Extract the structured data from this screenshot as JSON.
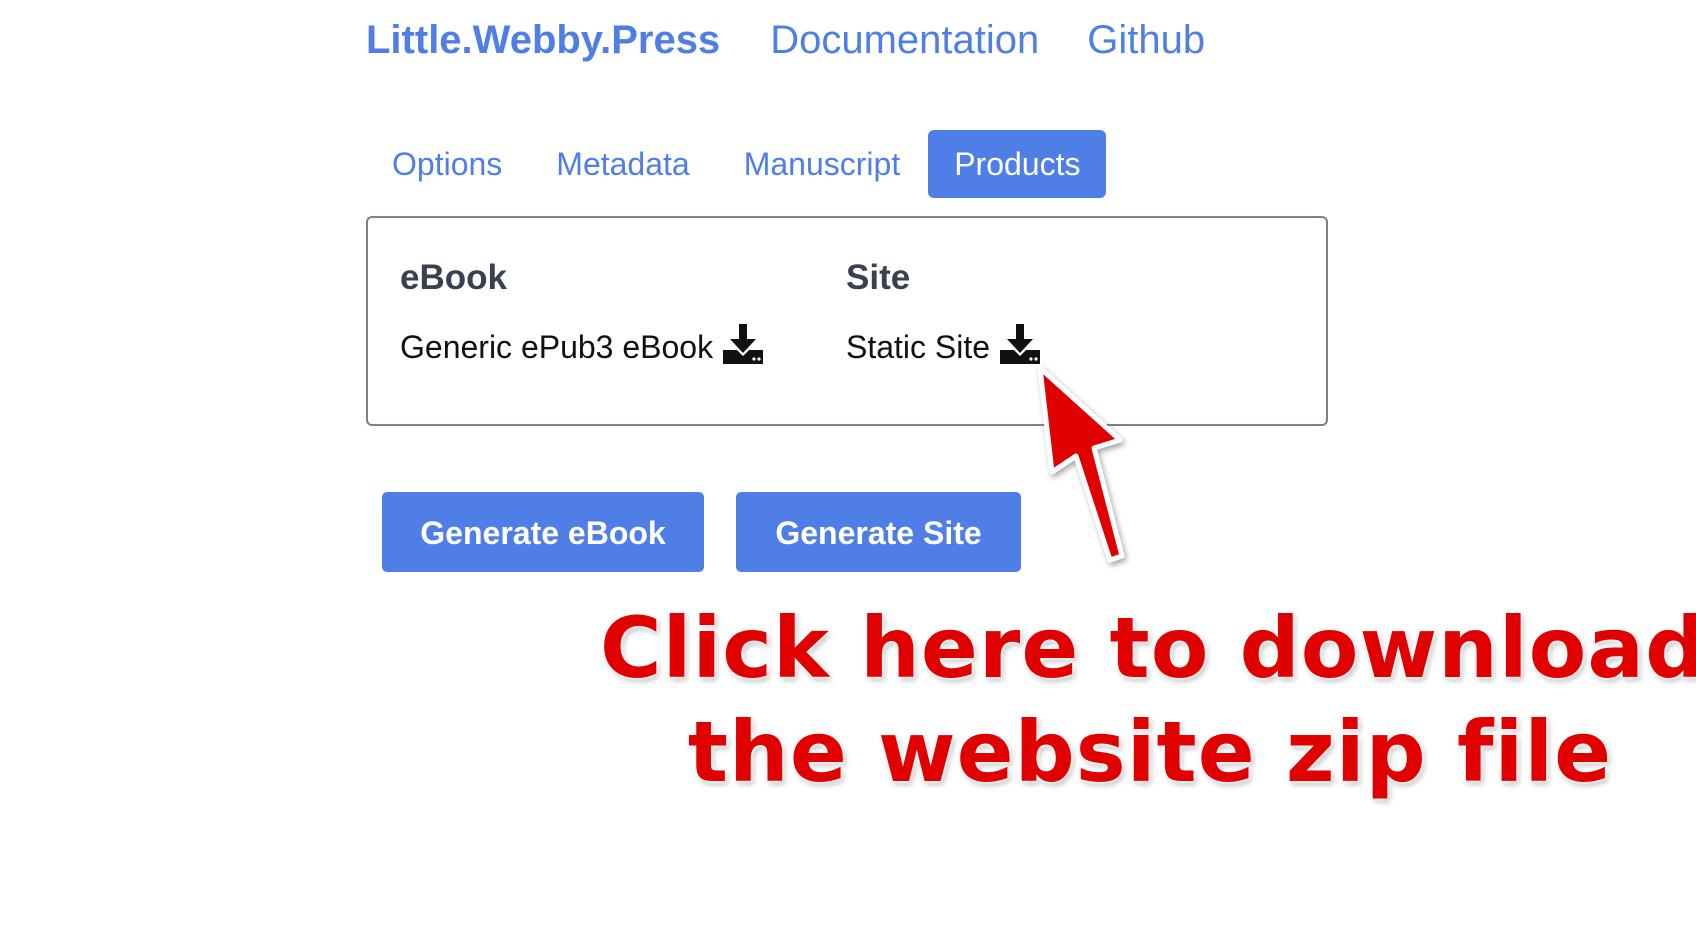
{
  "topnav": {
    "brand": "Little.Webby.Press",
    "documentation": "Documentation",
    "github": "Github"
  },
  "tabs": [
    {
      "label": "Options",
      "active": false
    },
    {
      "label": "Metadata",
      "active": false
    },
    {
      "label": "Manuscript",
      "active": false
    },
    {
      "label": "Products",
      "active": true
    }
  ],
  "products": {
    "ebook": {
      "heading": "eBook",
      "item": "Generic ePub3 eBook",
      "icon": "download-icon"
    },
    "site": {
      "heading": "Site",
      "item": "Static Site",
      "icon": "download-icon"
    }
  },
  "buttons": {
    "generate_ebook": "Generate eBook",
    "generate_site": "Generate Site"
  },
  "annotation": {
    "line1": "Click here to download",
    "line2": "the website zip file",
    "color": "#e00000"
  },
  "colors": {
    "accent": "#4f7fe6",
    "heading": "#394150"
  }
}
